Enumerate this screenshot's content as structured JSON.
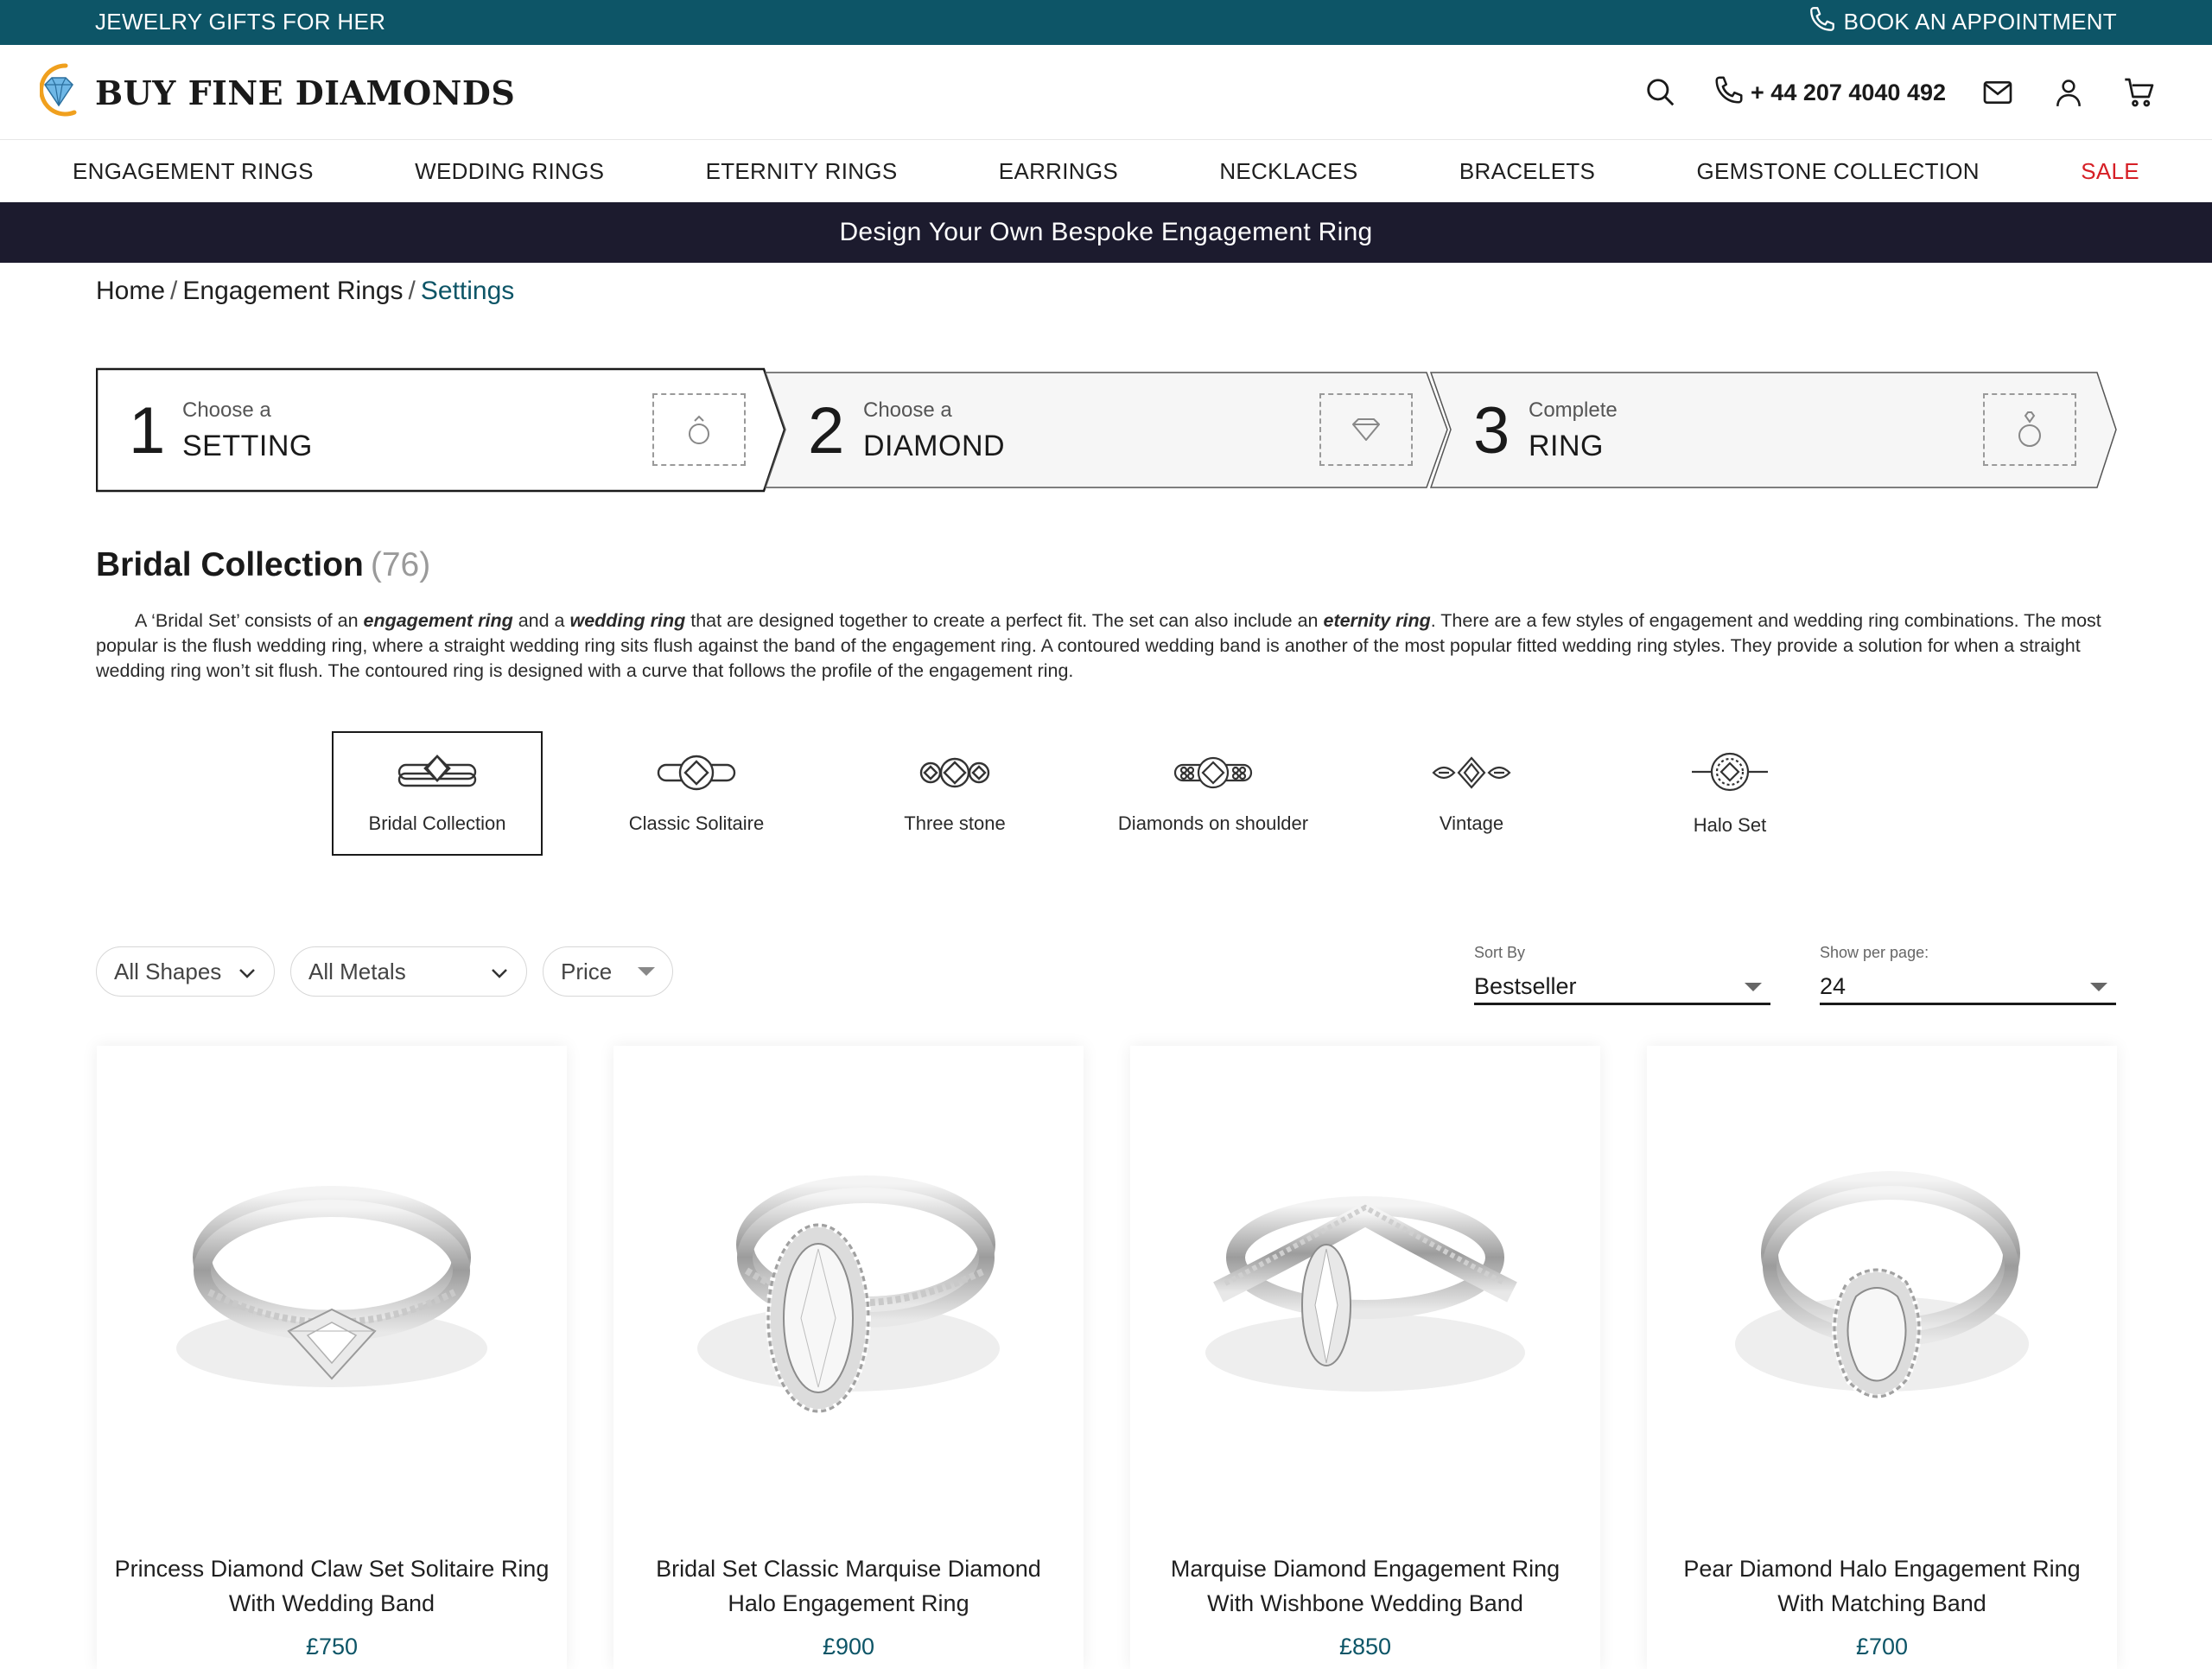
{
  "topbar": {
    "promo": "JEWELRY GIFTS FOR HER",
    "book_appointment": "BOOK AN APPOINTMENT",
    "background": "#0d5567"
  },
  "header": {
    "logo_text": "BUY FINE DIAMONDS",
    "phone": "+ 44 207 4040 492",
    "icons": [
      "search-icon",
      "phone-icon",
      "mail-icon",
      "user-icon",
      "cart-icon"
    ]
  },
  "nav": {
    "items": [
      "ENGAGEMENT RINGS",
      "WEDDING RINGS",
      "ETERNITY RINGS",
      "EARRINGS",
      "NECKLACES",
      "BRACELETS",
      "GEMSTONE COLLECTION",
      "SALE"
    ],
    "sale_color": "#d61f26"
  },
  "banner": {
    "text": "Design Your Own Bespoke Engagement Ring",
    "background": "#1c1b2e"
  },
  "breadcrumb": {
    "home": "Home",
    "level2": "Engagement Rings",
    "current": "Settings"
  },
  "steps": [
    {
      "number": "1",
      "small": "Choose a",
      "big": "SETTING",
      "icon": "ring-icon"
    },
    {
      "number": "2",
      "small": "Choose a",
      "big": "DIAMOND",
      "icon": "diamond-icon"
    },
    {
      "number": "3",
      "small": "Complete",
      "big": "RING",
      "icon": "ring-with-diamond-icon"
    }
  ],
  "collection": {
    "title": "Bridal Collection",
    "count": "(76)",
    "desc": {
      "p1": "A ‘Bridal Set’ consists of an ",
      "b1": "engagement ring",
      "p2": " and a ",
      "b2": "wedding ring",
      "p3": " that are designed together to create a perfect fit. The set can also include an ",
      "b3": "eternity ring",
      "p4": ". There are a few styles of engagement and wedding ring combinations. The most popular is the flush wedding ring, where a straight wedding ring sits flush against the band of the engagement ring. A contoured wedding band is another of the most popular fitted wedding ring styles. They provide a solution for when a straight wedding ring won’t sit flush. The contoured ring is designed with a curve that follows the profile of the engagement ring."
    }
  },
  "styles": [
    {
      "label": "Bridal Collection",
      "icon": "bridal-set-icon",
      "active": true
    },
    {
      "label": "Classic Solitaire",
      "icon": "solitaire-icon",
      "active": false
    },
    {
      "label": "Three stone",
      "icon": "three-stone-icon",
      "active": false
    },
    {
      "label": "Diamonds on shoulder",
      "icon": "shoulder-diamonds-icon",
      "active": false
    },
    {
      "label": "Vintage",
      "icon": "vintage-icon",
      "active": false
    },
    {
      "label": "Halo Set",
      "icon": "halo-icon",
      "active": false
    }
  ],
  "filters": {
    "shapes": "All Shapes",
    "metals": "All Metals",
    "price": "Price"
  },
  "sort": {
    "caption": "Sort By",
    "value": "Bestseller"
  },
  "per_page": {
    "caption": "Show per page:",
    "value": "24"
  },
  "products": [
    {
      "name": "Princess Diamond Claw Set Solitaire Ring With Wedding Band",
      "price": "£750",
      "stone": "princess"
    },
    {
      "name": "Bridal Set Classic Marquise Diamond Halo Engagement Ring",
      "price": "£900",
      "stone": "marquise-halo"
    },
    {
      "name": "Marquise Diamond Engagement Ring With Wishbone Wedding Band",
      "price": "£850",
      "stone": "marquise-wishbone"
    },
    {
      "name": "Pear Diamond Halo Engagement Ring With Matching Band",
      "price": "£700",
      "stone": "pear-halo"
    }
  ]
}
